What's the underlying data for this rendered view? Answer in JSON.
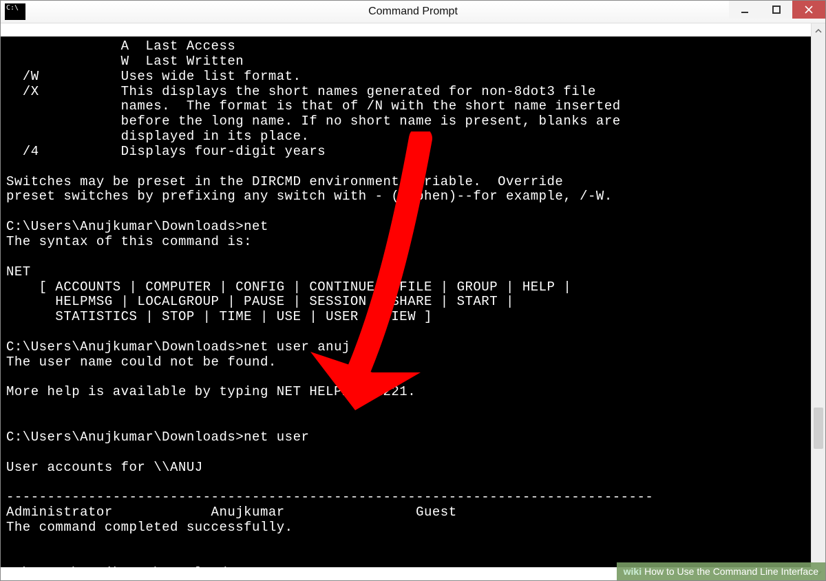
{
  "window": {
    "title": "Command Prompt"
  },
  "terminal": {
    "lines": [
      "              A  Last Access",
      "              W  Last Written",
      "  /W          Uses wide list format.",
      "  /X          This displays the short names generated for non-8dot3 file",
      "              names.  The format is that of /N with the short name inserted",
      "              before the long name. If no short name is present, blanks are",
      "              displayed in its place.",
      "  /4          Displays four-digit years",
      "",
      "Switches may be preset in the DIRCMD environment variable.  Override",
      "preset switches by prefixing any switch with - (hyphen)--for example, /-W.",
      "",
      "C:\\Users\\Anujkumar\\Downloads>net",
      "The syntax of this command is:",
      "",
      "NET",
      "    [ ACCOUNTS | COMPUTER | CONFIG | CONTINUE | FILE | GROUP | HELP |",
      "      HELPMSG | LOCALGROUP | PAUSE | SESSION | SHARE | START |",
      "      STATISTICS | STOP | TIME | USE | USER | VIEW ]",
      "",
      "C:\\Users\\Anujkumar\\Downloads>net user anuj",
      "The user name could not be found.",
      "",
      "More help is available by typing NET HELPMSG 2221.",
      "",
      "",
      "C:\\Users\\Anujkumar\\Downloads>net user",
      "",
      "User accounts for \\\\ANUJ",
      "",
      "-------------------------------------------------------------------------------",
      "Administrator            Anujkumar                Guest",
      "The command completed successfully.",
      "",
      "",
      "C:\\Users\\Anujkumar\\Downloads>"
    ]
  },
  "footer": {
    "brand": "wiki",
    "text": "How to Use the Command Line Interface"
  },
  "annotation": {
    "color": "#ff0000"
  }
}
